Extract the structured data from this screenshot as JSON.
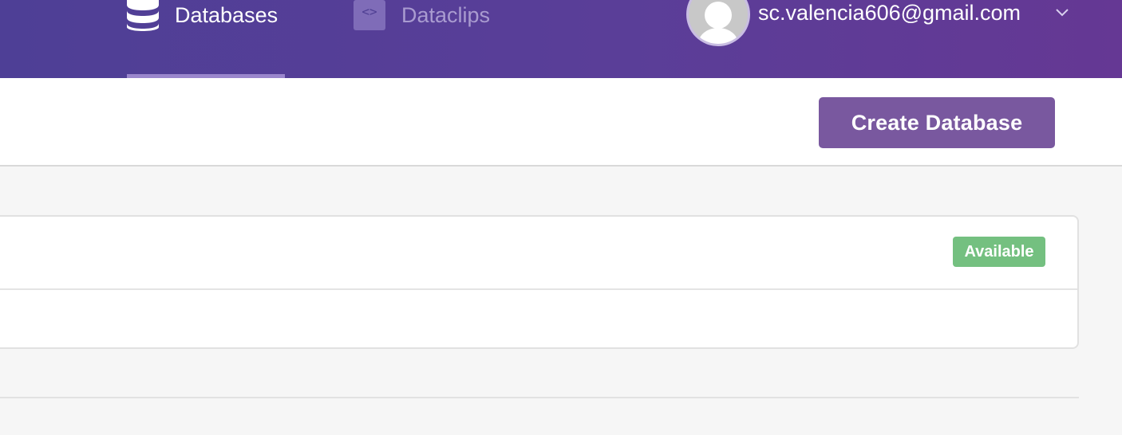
{
  "nav": {
    "databases_label": "Databases",
    "dataclips_label": "Dataclips",
    "dataclips_icon_text": "<>"
  },
  "account": {
    "email": "sc.valencia606@gmail.com"
  },
  "toolbar": {
    "create_label": "Create Database"
  },
  "database_card": {
    "status": "Available"
  },
  "colors": {
    "header": "#5a3e98",
    "button": "#79589f",
    "status_available": "#74c080"
  },
  "icons": [
    "database-icon",
    "dataclips-icon",
    "avatar",
    "chevron-down-icon"
  ]
}
